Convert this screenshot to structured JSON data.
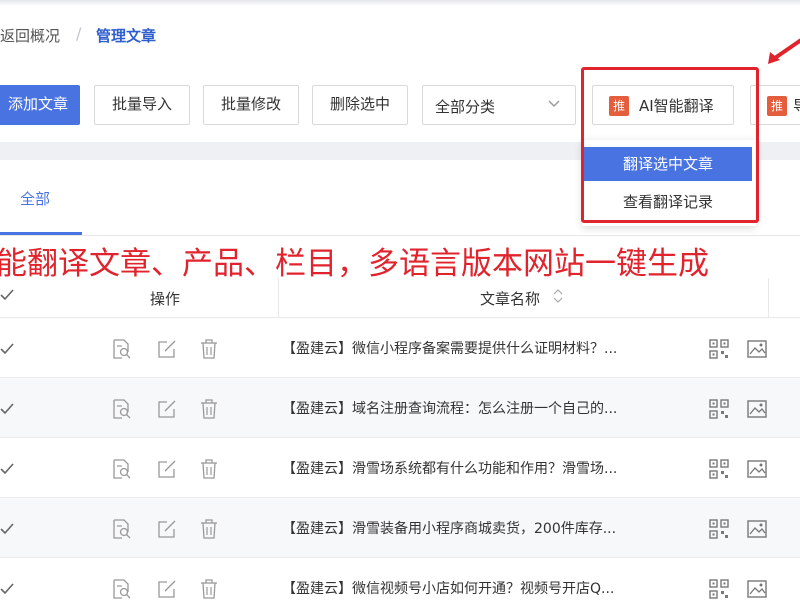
{
  "breadcrumb": {
    "back": "返回概况",
    "separator": "/",
    "current": "管理文章"
  },
  "toolbar": {
    "add": "添加文章",
    "import": "批量导入",
    "batch_edit": "批量修改",
    "delete_selected": "删除选中",
    "category_select": "全部分类",
    "ai_tag": "推",
    "ai_translate": "AI智能翻译",
    "next_tag": "推",
    "next_label": "导"
  },
  "dropdown": {
    "items": [
      "翻译选中文章",
      "查看翻译记录"
    ]
  },
  "tabs": {
    "all": "全部"
  },
  "banner": {
    "text": "能翻译文章、产品、栏目，多语言版本网站一键生成"
  },
  "table": {
    "headers": {
      "ops": "操作",
      "title": "文章名称"
    },
    "rows": [
      {
        "title": "【盈建云】微信小程序备案需要提供什么证明材料？..."
      },
      {
        "title": "【盈建云】域名注册查询流程：怎么注册一个自己的..."
      },
      {
        "title": "【盈建云】滑雪场系统都有什么功能和作用？滑雪场..."
      },
      {
        "title": "【盈建云】滑雪装备用小程序商城卖货，200件库存..."
      },
      {
        "title": "【盈建云】微信视频号小店如何开通？视频号开店Q..."
      }
    ]
  },
  "colors": {
    "primary": "#4a73e2",
    "annotation_red": "#e0232c",
    "tag_orange": "#e45d3c"
  }
}
